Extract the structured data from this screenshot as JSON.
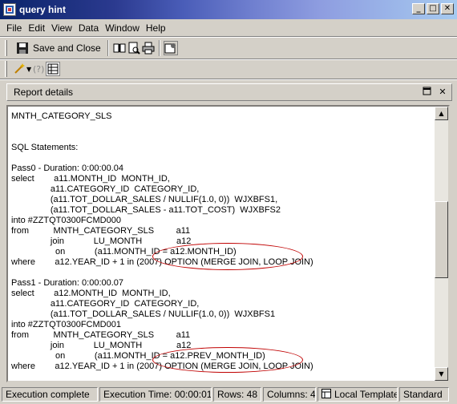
{
  "window": {
    "title": "query hint",
    "minimize": "_",
    "maximize": "□",
    "close": "✕"
  },
  "menu": [
    {
      "label": "File"
    },
    {
      "label": "Edit"
    },
    {
      "label": "View"
    },
    {
      "label": "Data"
    },
    {
      "label": "Window"
    },
    {
      "label": "Help"
    }
  ],
  "toolbar": {
    "save_close_label": "Save and Close"
  },
  "panel": {
    "title": "Report details"
  },
  "report": {
    "lines": [
      {
        "text": "MNTH_CATEGORY_SLS"
      },
      {
        "text": "SQL Statements:"
      },
      {
        "text": "Pass0 - Duration: 0:00:00.04"
      },
      {
        "text": "select        a11.MONTH_ID  MONTH_ID,"
      },
      {
        "text": "                a11.CATEGORY_ID  CATEGORY_ID,"
      },
      {
        "text": "                (a11.TOT_DOLLAR_SALES / NULLIF(1.0, 0))  WJXBFS1,"
      },
      {
        "text": "                (a11.TOT_DOLLAR_SALES - a11.TOT_COST)  WJXBFS2"
      },
      {
        "text": "into #ZZTQT0300FCMD000"
      },
      {
        "text": "from          MNTH_CATEGORY_SLS         a11"
      },
      {
        "text": "                join            LU_MONTH              a12"
      },
      {
        "text": "                  on            (a11.MONTH_ID = a12.MONTH_ID)"
      },
      {
        "text": "where        a12.YEAR_ID + 1 in (2007) OPTION (MERGE JOIN, LOOP JOIN)"
      },
      {
        "text": "Pass1 - Duration: 0:00:00.07"
      },
      {
        "text": "select        a12.MONTH_ID  MONTH_ID,"
      },
      {
        "text": "                a11.CATEGORY_ID  CATEGORY_ID,"
      },
      {
        "text": "                (a11.TOT_DOLLAR_SALES / NULLIF(1.0, 0))  WJXBFS1"
      },
      {
        "text": "into #ZZTQT0300FCMD001"
      },
      {
        "text": "from          MNTH_CATEGORY_SLS         a11"
      },
      {
        "text": "                join            LU_MONTH              a12"
      },
      {
        "text": "                  on            (a11.MONTH_ID = a12.PREV_MONTH_ID)"
      },
      {
        "text": "where        a12.YEAR_ID + 1 in (2007) OPTION (MERGE JOIN, LOOP JOIN)"
      }
    ]
  },
  "status": {
    "state": "Execution complete",
    "time": "Execution Time: 00:00:01",
    "rows": "Rows: 48",
    "columns": "Columns: 4",
    "template": "Local Template",
    "mode": "Standard"
  }
}
